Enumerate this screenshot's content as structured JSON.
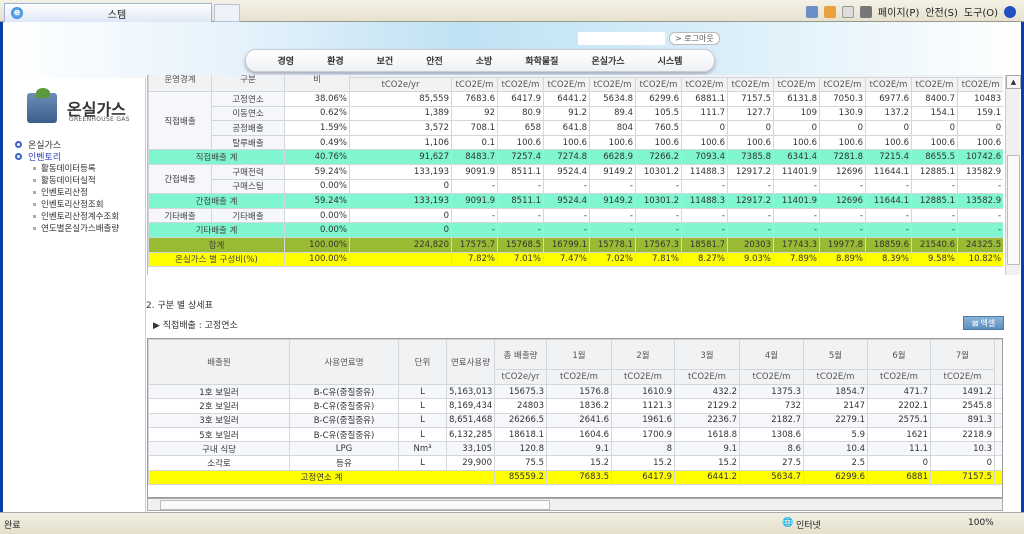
{
  "browser": {
    "tab_title": "스템",
    "tools": [
      "페이지(P)",
      "안전(S)",
      "도구(O)"
    ],
    "icons": [
      "home-icon",
      "rss-icon",
      "mail-icon",
      "print-icon",
      "help-icon"
    ]
  },
  "header": {
    "logout": "> 로그아웃",
    "nav": [
      "경영",
      "환경",
      "보건",
      "안전",
      "소방",
      "화학물질",
      "온실가스",
      "시스템"
    ]
  },
  "sidebar": {
    "logo_ko": "온실가스",
    "logo_en": "GREENHOUSE GAS",
    "menu": [
      {
        "label": "온실가스",
        "active": false
      },
      {
        "label": "인벤토리",
        "active": true
      }
    ],
    "submenu": [
      "활동데이터등록",
      "활동데이터실적",
      "인벤토리산정",
      "인벤토리산정조회",
      "인벤토리산정계수조회",
      "연도별온실가스배출량"
    ]
  },
  "summary": {
    "headers": [
      "운영경계",
      "구분",
      "비"
    ],
    "units": [
      "tCO2e/yr",
      "tCO2E/m",
      "tCO2E/m",
      "tCO2E/m",
      "tCO2E/m",
      "tCO2E/m",
      "tCO2E/m",
      "tCO2E/m",
      "tCO2E/m",
      "tCO2E/m",
      "tCO2E/m",
      "tCO2E/m",
      "tCO2E/m"
    ],
    "rows": [
      {
        "group": "직접배출",
        "span": 4,
        "type": "고정연소",
        "pct": "38.06%",
        "vals": [
          "85,559",
          "7683.6",
          "6417.9",
          "6441.2",
          "5634.8",
          "6299.6",
          "6881.1",
          "7157.5",
          "6131.8",
          "7050.3",
          "6977.6",
          "8400.7",
          "10483"
        ]
      },
      {
        "type": "이동연소",
        "pct": "0.62%",
        "vals": [
          "1,389",
          "92",
          "80.9",
          "91.2",
          "89.4",
          "105.5",
          "111.7",
          "127.7",
          "109",
          "130.9",
          "137.2",
          "154.1",
          "159.1"
        ]
      },
      {
        "type": "공정배출",
        "pct": "1.59%",
        "vals": [
          "3,572",
          "708.1",
          "658",
          "641.8",
          "804",
          "760.5",
          "0",
          "0",
          "0",
          "0",
          "0",
          "0",
          "0"
        ]
      },
      {
        "type": "탈루배출",
        "pct": "0.49%",
        "vals": [
          "1,106",
          "0.1",
          "100.6",
          "100.6",
          "100.6",
          "100.6",
          "100.6",
          "100.6",
          "100.6",
          "100.6",
          "100.6",
          "100.6",
          "100.6"
        ]
      },
      {
        "subtotal": "직접배출 계",
        "style": "sub",
        "pct": "40.76%",
        "vals": [
          "91,627",
          "8483.7",
          "7257.4",
          "7274.8",
          "6628.9",
          "7266.2",
          "7093.4",
          "7385.8",
          "6341.4",
          "7281.8",
          "7215.4",
          "8655.5",
          "10742.6"
        ]
      },
      {
        "group": "간접배출",
        "span": 2,
        "type": "구매전력",
        "pct": "59.24%",
        "vals": [
          "133,193",
          "9091.9",
          "8511.1",
          "9524.4",
          "9149.2",
          "10301.2",
          "11488.3",
          "12917.2",
          "11401.9",
          "12696",
          "11644.1",
          "12885.1",
          "13582.9"
        ]
      },
      {
        "type": "구매스팀",
        "pct": "0.00%",
        "vals": [
          "0",
          "-",
          "-",
          "-",
          "-",
          "-",
          "-",
          "-",
          "-",
          "-",
          "-",
          "-",
          "-"
        ]
      },
      {
        "subtotal": "간접배출 계",
        "style": "sub",
        "pct": "59.24%",
        "vals": [
          "133,193",
          "9091.9",
          "8511.1",
          "9524.4",
          "9149.2",
          "10301.2",
          "11488.3",
          "12917.2",
          "11401.9",
          "12696",
          "11644.1",
          "12885.1",
          "13582.9"
        ]
      },
      {
        "group": "기타배출",
        "span": 1,
        "type": "기타배출",
        "pct": "0.00%",
        "vals": [
          "0",
          "-",
          "-",
          "-",
          "-",
          "-",
          "-",
          "-",
          "-",
          "-",
          "-",
          "-",
          "-"
        ]
      },
      {
        "subtotal": "기타배출 계",
        "style": "sub",
        "pct": "0.00%",
        "vals": [
          "0",
          "-",
          "-",
          "-",
          "-",
          "-",
          "-",
          "-",
          "-",
          "-",
          "-",
          "-",
          "-"
        ]
      },
      {
        "subtotal": "합계",
        "style": "tot",
        "pct": "100.00%",
        "vals": [
          "224,820",
          "17575.7",
          "15768.5",
          "16799.1",
          "15778.1",
          "17567.3",
          "18581.7",
          "20303",
          "17743.3",
          "19977.8",
          "18859.6",
          "21540.6",
          "24325.5"
        ]
      },
      {
        "subtotal": "온실가스 별 구성비(%)",
        "style": "pct",
        "pct": "100.00%",
        "vals": [
          "",
          "7.82%",
          "7.01%",
          "7.47%",
          "7.02%",
          "7.81%",
          "8.27%",
          "9.03%",
          "7.89%",
          "8.89%",
          "8.39%",
          "9.58%",
          "10.82%"
        ]
      }
    ]
  },
  "detail": {
    "section_title": "2. 구분 별 상세표",
    "subtitle": "▶ 직접배출 : 고정연소",
    "excel_label": "엑셀",
    "headers": [
      "배출원",
      "사용연료명",
      "단위",
      "연료사용량",
      "총 배출량",
      "1월",
      "2월",
      "3월",
      "4월",
      "5월",
      "6월",
      "7월"
    ],
    "units": [
      "tCO2e/yr",
      "tCO2E/m",
      "tCO2E/m",
      "tCO2E/m",
      "tCO2E/m",
      "tCO2E/m",
      "tCO2E/m",
      "tCO2E/m"
    ],
    "rows": [
      [
        "1호 보일러",
        "B-C유(중질중유)",
        "L",
        "5,163,013",
        "15675.3",
        "1576.8",
        "1610.9",
        "432.2",
        "1375.3",
        "1854.7",
        "471.7",
        "1491.2"
      ],
      [
        "2호 보일러",
        "B-C유(중질중유)",
        "L",
        "8,169,434",
        "24803",
        "1836.2",
        "1121.3",
        "2129.2",
        "732",
        "2147",
        "2202.1",
        "2545.8"
      ],
      [
        "3호 보일러",
        "B-C유(중질중유)",
        "L",
        "8,651,468",
        "26266.5",
        "2641.6",
        "1961.6",
        "2236.7",
        "2182.7",
        "2279.1",
        "2575.1",
        "891.3"
      ],
      [
        "5호 보일러",
        "B-C유(중질중유)",
        "L",
        "6,132,285",
        "18618.1",
        "1604.6",
        "1700.9",
        "1618.8",
        "1308.6",
        "5.9",
        "1621",
        "2218.9"
      ],
      [
        "구내 식당",
        "LPG",
        "Nm³",
        "33,105",
        "120.8",
        "9.1",
        "8",
        "9.1",
        "8.6",
        "10.4",
        "11.1",
        "10.3"
      ],
      [
        "소각로",
        "등유",
        "L",
        "29,900",
        "75.5",
        "15.2",
        "15.2",
        "15.2",
        "27.5",
        "2.5",
        "0",
        "0"
      ]
    ],
    "total": {
      "label": "고정연소 계",
      "vals": [
        "85559.2",
        "7683.5",
        "6417.9",
        "6441.2",
        "5634.7",
        "6299.6",
        "6881",
        "7157.5"
      ]
    }
  },
  "status": {
    "left": "완료",
    "zone": "인터넷",
    "zoom": "100%"
  }
}
